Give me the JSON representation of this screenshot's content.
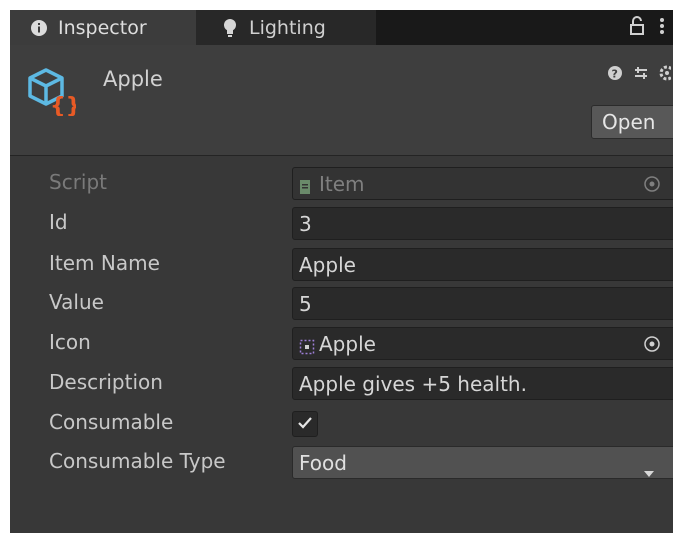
{
  "tabs": [
    {
      "label": "Inspector",
      "icon": "info-icon"
    },
    {
      "label": "Lighting",
      "icon": "lightbulb-icon"
    }
  ],
  "header": {
    "title": "Apple",
    "open_label": "Open"
  },
  "properties": [
    {
      "label": "Script",
      "value": "Item",
      "kind": "object",
      "disabled": true
    },
    {
      "label": "Id",
      "value": "3",
      "kind": "text"
    },
    {
      "label": "Item Name",
      "value": "Apple",
      "kind": "text"
    },
    {
      "label": "Value",
      "value": "5",
      "kind": "text"
    },
    {
      "label": "Icon",
      "value": "Apple",
      "kind": "object"
    },
    {
      "label": "Description",
      "value": "Apple gives +5 health.",
      "kind": "text"
    },
    {
      "label": "Consumable",
      "value": true,
      "kind": "checkbox"
    },
    {
      "label": "Consumable Type",
      "value": "Food",
      "kind": "dropdown"
    }
  ],
  "colors": {
    "panel_bg": "#383838",
    "tabbar_bg": "#191919",
    "field_bg": "#2a2a2a",
    "accent_orange": "#e85a25",
    "accent_blue": "#5db9e3"
  }
}
